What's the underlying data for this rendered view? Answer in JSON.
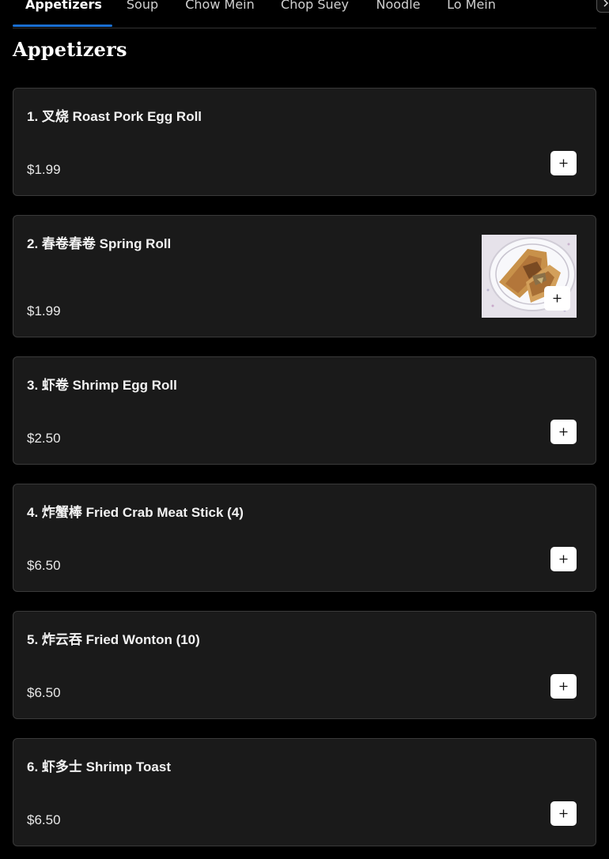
{
  "tabs": [
    {
      "label": "Appetizers",
      "active": true
    },
    {
      "label": "Soup",
      "active": false
    },
    {
      "label": "Chow Mein",
      "active": false
    },
    {
      "label": "Chop Suey",
      "active": false
    },
    {
      "label": "Noodle",
      "active": false
    },
    {
      "label": "Lo Mein",
      "active": false
    }
  ],
  "scroll_right_icon": "chevron-right-icon",
  "section": {
    "title": "Appetizers"
  },
  "items": [
    {
      "name": "1. 叉烧 Roast Pork Egg Roll",
      "price": "$1.99",
      "has_image": false
    },
    {
      "name": "2. 春卷春卷 Spring Roll",
      "price": "$1.99",
      "has_image": true
    },
    {
      "name": "3. 虾卷 Shrimp Egg Roll",
      "price": "$2.50",
      "has_image": false
    },
    {
      "name": "4. 炸蟹棒 Fried Crab Meat Stick (4)",
      "price": "$6.50",
      "has_image": false
    },
    {
      "name": "5. 炸云吞 Fried Wonton (10)",
      "price": "$6.50",
      "has_image": false
    },
    {
      "name": "6. 虾多士 Shrimp Toast",
      "price": "$6.50",
      "has_image": false
    }
  ],
  "add_icon": "plus-icon",
  "colors": {
    "accent": "#1a6fd1",
    "background": "#000000",
    "card": "#1a1a1a",
    "border": "#3a3a3a"
  }
}
